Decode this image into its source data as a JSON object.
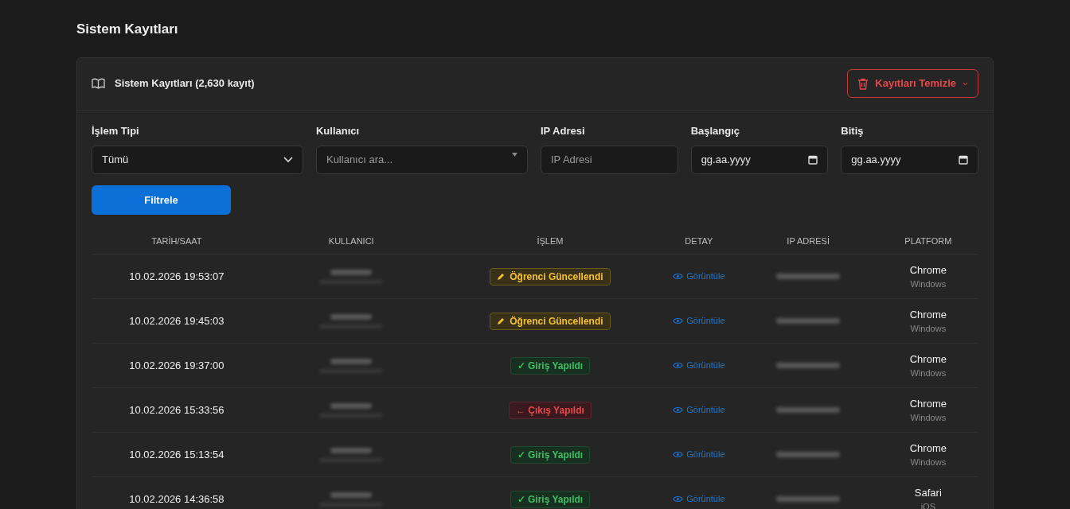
{
  "page_title": "Sistem Kayıtları",
  "card": {
    "title": "Sistem Kayıtları (2,630 kayıt)",
    "clear_button": "Kayıtları Temizle"
  },
  "filters": [
    {
      "kind": "select",
      "label": "İşlem Tipi",
      "value": "Tümü"
    },
    {
      "kind": "combo",
      "label": "Kullanıcı",
      "placeholder": "Kullanıcı ara..."
    },
    {
      "kind": "text",
      "label": "IP Adresi",
      "placeholder": "IP Adresi"
    },
    {
      "kind": "date",
      "label": "Başlangıç",
      "value": "gg.aa.yyyy"
    },
    {
      "kind": "date",
      "label": "Bitiş",
      "value": "gg.aa.yyyy"
    }
  ],
  "filter_button": "Filtrele",
  "table": {
    "columns": [
      "TARİH/SAAT",
      "KULLANICI",
      "İŞLEM",
      "DETAY",
      "IP ADRESİ",
      "PLATFORM"
    ],
    "rows": [
      {
        "time": "10.02.2026 19:53:07",
        "action": {
          "kind": "update",
          "label": "Öğrenci Güncellendi"
        },
        "detail": "Görüntüle",
        "browser": "Chrome",
        "os": "Windows"
      },
      {
        "time": "10.02.2026 19:45:03",
        "action": {
          "kind": "update",
          "label": "Öğrenci Güncellendi"
        },
        "detail": "Görüntüle",
        "browser": "Chrome",
        "os": "Windows"
      },
      {
        "time": "10.02.2026 19:37:00",
        "action": {
          "kind": "login",
          "label": "✓ Giriş Yapıldı"
        },
        "detail": "Görüntüle",
        "browser": "Chrome",
        "os": "Windows"
      },
      {
        "time": "10.02.2026 15:33:56",
        "action": {
          "kind": "logout",
          "label": "← Çıkış Yapıldı"
        },
        "detail": "Görüntüle",
        "browser": "Chrome",
        "os": "Windows"
      },
      {
        "time": "10.02.2026 15:13:54",
        "action": {
          "kind": "login",
          "label": "✓ Giriş Yapıldı"
        },
        "detail": "Görüntüle",
        "browser": "Chrome",
        "os": "Windows"
      },
      {
        "time": "10.02.2026 14:36:58",
        "action": {
          "kind": "login",
          "label": "✓ Giriş Yapıldı"
        },
        "detail": "Görüntüle",
        "browser": "Safari",
        "os": "iOS"
      }
    ]
  }
}
